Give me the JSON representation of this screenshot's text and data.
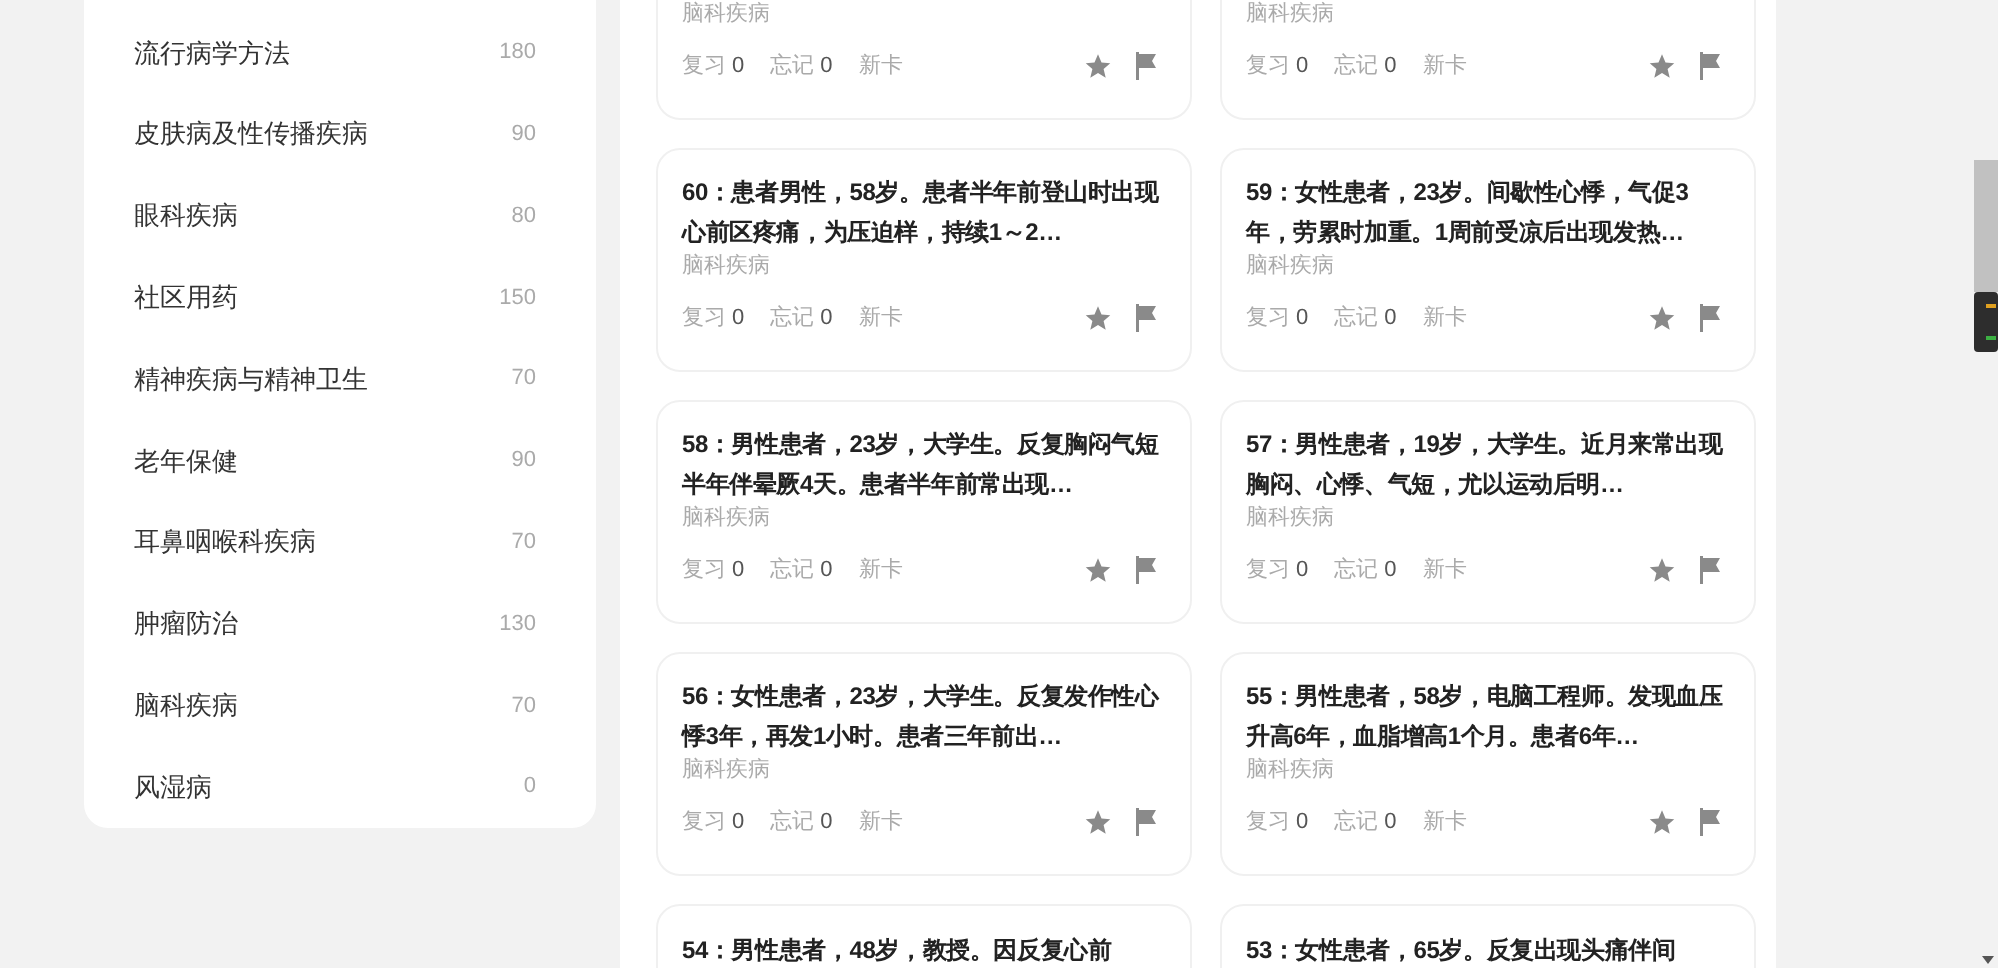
{
  "sidebar": {
    "items": [
      {
        "label": "流行病学方法",
        "count": "180"
      },
      {
        "label": "皮肤病及性传播疾病",
        "count": "90"
      },
      {
        "label": "眼科疾病",
        "count": "80"
      },
      {
        "label": "社区用药",
        "count": "150"
      },
      {
        "label": "精神疾病与精神卫生",
        "count": "70"
      },
      {
        "label": "老年保健",
        "count": "90"
      },
      {
        "label": "耳鼻咽喉科疾病",
        "count": "70"
      },
      {
        "label": "肿瘤防治",
        "count": "130"
      },
      {
        "label": "脑科疾病",
        "count": "70"
      },
      {
        "label": "风湿病",
        "count": "0"
      }
    ]
  },
  "cards": [
    {
      "category": "脑科疾病",
      "stats": [
        {
          "label": "复习",
          "count": "0"
        },
        {
          "label": "忘记",
          "count": "0"
        },
        {
          "label": "新卡"
        }
      ]
    },
    {
      "category": "脑科疾病",
      "stats": [
        {
          "label": "复习",
          "count": "0"
        },
        {
          "label": "忘记",
          "count": "0"
        },
        {
          "label": "新卡"
        }
      ]
    },
    {
      "title": "60：患者男性，58岁。患者半年前登山时出现心前区疼痛，为压迫样，持续1～2…",
      "category": "脑科疾病",
      "stats": [
        {
          "label": "复习",
          "count": "0"
        },
        {
          "label": "忘记",
          "count": "0"
        },
        {
          "label": "新卡"
        }
      ]
    },
    {
      "title": "59：女性患者，23岁。间歇性心悸，气促3年，劳累时加重。1周前受凉后出现发热…",
      "category": "脑科疾病",
      "stats": [
        {
          "label": "复习",
          "count": "0"
        },
        {
          "label": "忘记",
          "count": "0"
        },
        {
          "label": "新卡"
        }
      ]
    },
    {
      "title": "58：男性患者，23岁，大学生。反复胸闷气短半年伴晕厥4天。患者半年前常出现…",
      "category": "脑科疾病",
      "stats": [
        {
          "label": "复习",
          "count": "0"
        },
        {
          "label": "忘记",
          "count": "0"
        },
        {
          "label": "新卡"
        }
      ]
    },
    {
      "title": "57：男性患者，19岁，大学生。近月来常出现胸闷、心悸、气短，尤以运动后明…",
      "category": "脑科疾病",
      "stats": [
        {
          "label": "复习",
          "count": "0"
        },
        {
          "label": "忘记",
          "count": "0"
        },
        {
          "label": "新卡"
        }
      ]
    },
    {
      "title": "56：女性患者，23岁，大学生。反复发作性心悸3年，再发1小时。患者三年前出…",
      "category": "脑科疾病",
      "stats": [
        {
          "label": "复习",
          "count": "0"
        },
        {
          "label": "忘记",
          "count": "0"
        },
        {
          "label": "新卡"
        }
      ]
    },
    {
      "title": "55：男性患者，58岁，电脑工程师。发现血压升高6年，血脂增高1个月。患者6年…",
      "category": "脑科疾病",
      "stats": [
        {
          "label": "复习",
          "count": "0"
        },
        {
          "label": "忘记",
          "count": "0"
        },
        {
          "label": "新卡"
        }
      ]
    },
    {
      "title": "54：男性患者，48岁，教授。因反复心前"
    },
    {
      "title": "53：女性患者，65岁。反复出现头痛伴间"
    }
  ]
}
